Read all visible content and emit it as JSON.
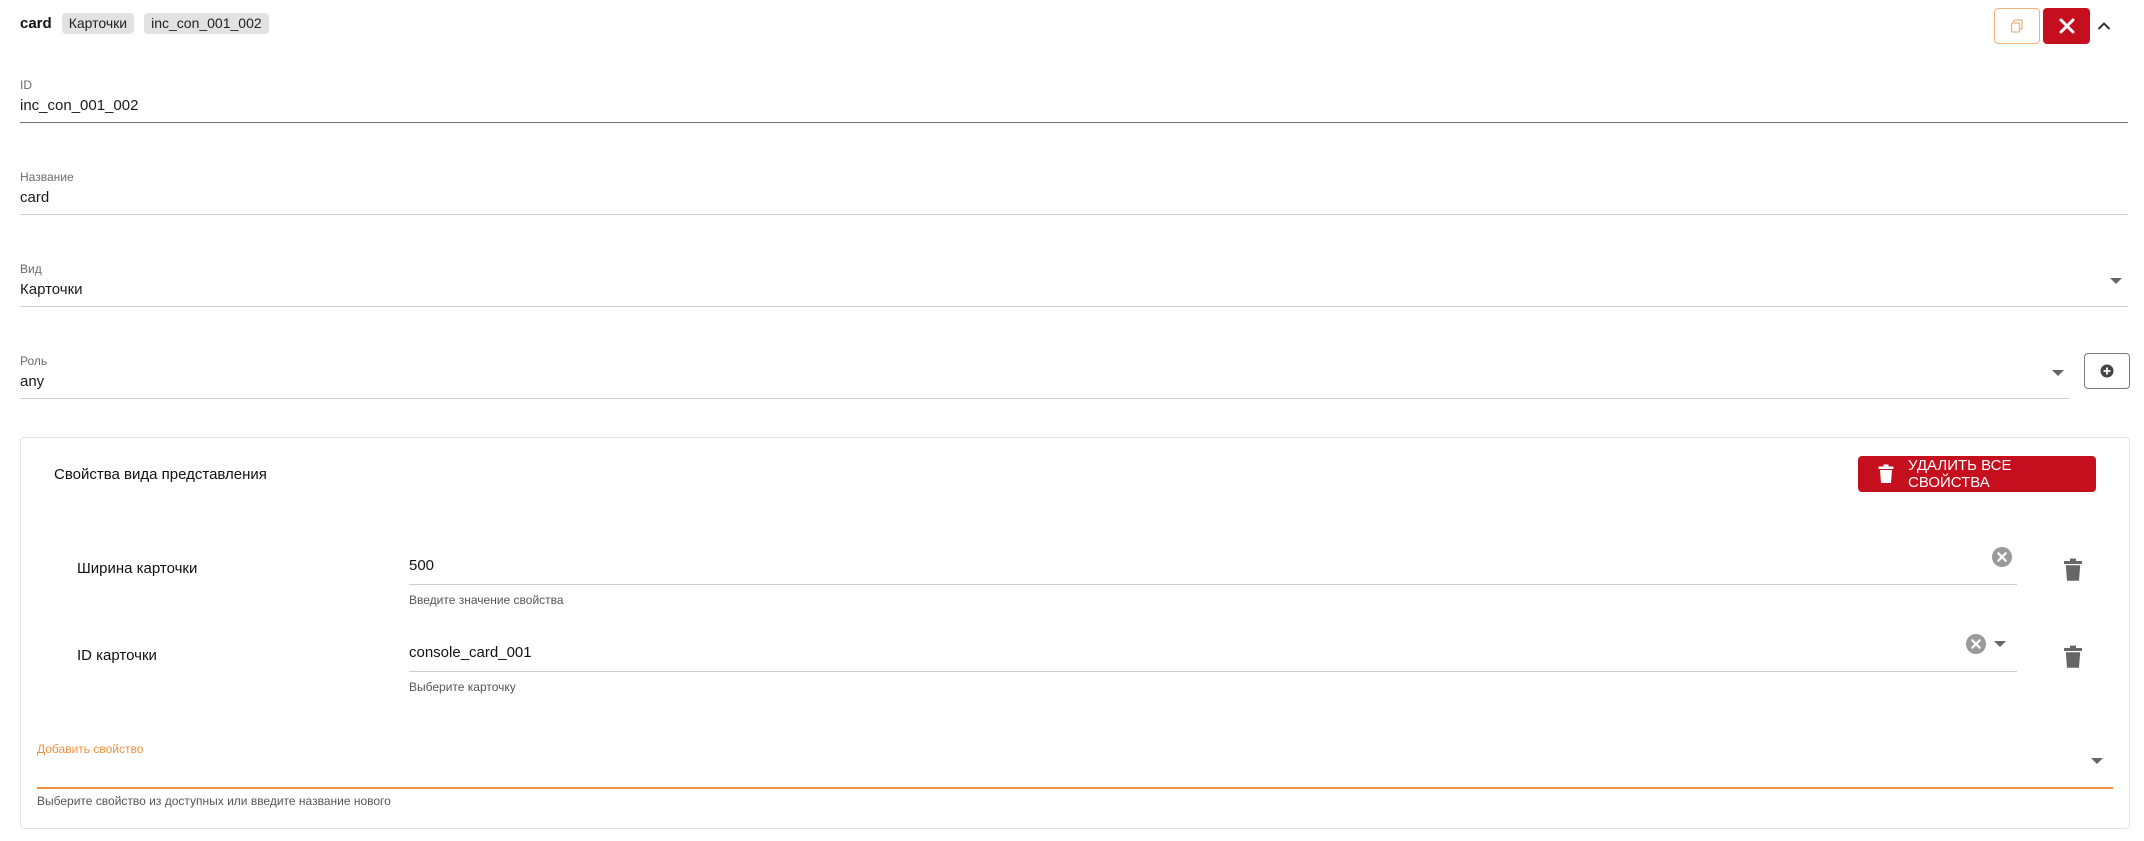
{
  "header": {
    "title": "card",
    "chips": [
      "Карточки",
      "inc_con_001_002"
    ]
  },
  "fields": {
    "id": {
      "label": "ID",
      "value": "inc_con_001_002"
    },
    "name": {
      "label": "Название",
      "value": "card"
    },
    "view": {
      "label": "Вид",
      "value": "Карточки"
    },
    "role": {
      "label": "Роль",
      "value": "any"
    }
  },
  "properties": {
    "title": "Свойства вида представления",
    "delete_all_label": "УДАЛИТЬ ВСЕ СВОЙСТВА",
    "items": [
      {
        "name": "Ширина карточки",
        "value": "500",
        "helper": "Введите значение свойства"
      },
      {
        "name": "ID карточки",
        "value": "console_card_001",
        "helper": "Выберите карточку"
      }
    ],
    "add": {
      "label": "Добавить свойство",
      "helper": "Выберите свойство из доступных или введите название нового"
    }
  },
  "colors": {
    "primary_red": "#c50f1f",
    "accent_orange": "#f0913d"
  },
  "icons": [
    "copy-icon",
    "close-icon",
    "chevron-up-icon",
    "plus-circle-icon",
    "trash-icon",
    "clear-circle-icon",
    "dropdown-arrow-icon"
  ]
}
